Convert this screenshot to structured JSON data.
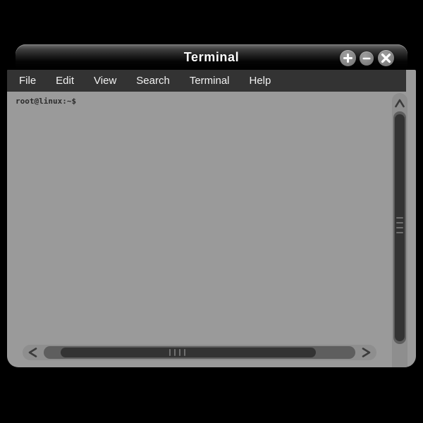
{
  "window": {
    "title": "Terminal",
    "controls": [
      {
        "name": "maximize-button",
        "icon": "plus-icon",
        "label": "+"
      },
      {
        "name": "minimize-button",
        "icon": "minus-icon",
        "label": "–"
      },
      {
        "name": "close-button",
        "icon": "close-icon",
        "label": "×"
      }
    ]
  },
  "menubar": {
    "items": [
      {
        "label": "File"
      },
      {
        "label": "Edit"
      },
      {
        "label": "View"
      },
      {
        "label": "Search"
      },
      {
        "label": "Terminal"
      },
      {
        "label": "Help"
      }
    ]
  },
  "terminal": {
    "prompt": "root@linux:~$",
    "lines": [],
    "background_color": "#9a9a9a",
    "text_color": "#2b2b2b"
  },
  "scrollbars": {
    "vertical": {
      "up_arrow": "∧",
      "down_arrow": "∨",
      "grip_marks": 4
    },
    "horizontal": {
      "left_arrow": "<",
      "right_arrow": ">",
      "grip_marks": 4
    }
  },
  "theme": {
    "desktop_background": "#000000",
    "titlebar_top": "#7d7d7d",
    "titlebar_bottom": "#000000",
    "menubar_background": "#333333",
    "menu_text": "#f2f2f2",
    "frame_background": "#9a9a9a",
    "scroll_track": "#5e5e5e",
    "scroll_thumb": "#333333"
  }
}
